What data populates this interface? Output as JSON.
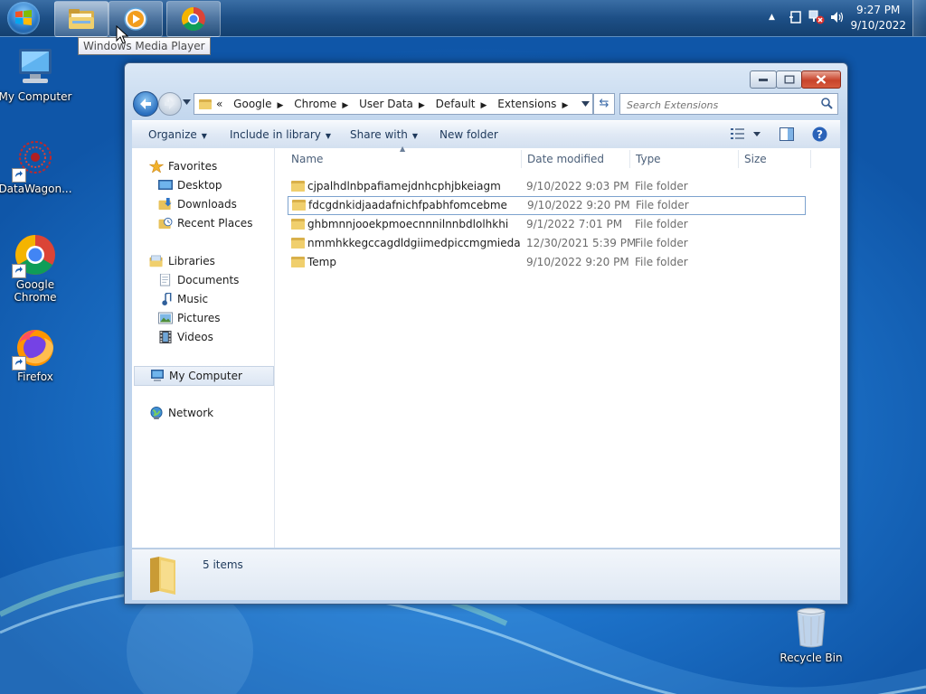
{
  "taskbar": {
    "tooltip": "Windows Media Player",
    "clock_time": "9:27 PM",
    "clock_date": "9/10/2022"
  },
  "desktop": {
    "icons": [
      {
        "label": "My Computer"
      },
      {
        "label": "DataWagon..."
      },
      {
        "label": "Google Chrome"
      },
      {
        "label": "Firefox"
      },
      {
        "label": "Recycle Bin"
      }
    ]
  },
  "window": {
    "breadcrumb_prefix": "«",
    "breadcrumbs": [
      "Google",
      "Chrome",
      "User Data",
      "Default",
      "Extensions"
    ],
    "search_placeholder": "Search Extensions",
    "commands": {
      "organize": "Organize",
      "include_in_library": "Include in library",
      "share_with": "Share with",
      "new_folder": "New folder"
    },
    "nav": {
      "favorites": "Favorites",
      "desktop": "Desktop",
      "downloads": "Downloads",
      "recent_places": "Recent Places",
      "libraries": "Libraries",
      "documents": "Documents",
      "music": "Music",
      "pictures": "Pictures",
      "videos": "Videos",
      "my_computer": "My Computer",
      "network": "Network"
    },
    "columns": {
      "name": "Name",
      "date_modified": "Date modified",
      "type": "Type",
      "size": "Size"
    },
    "files": [
      {
        "name": "cjpalhdlnbpafiamejdnhcphjbkeiagm",
        "date": "9/10/2022 9:03 PM",
        "type": "File folder"
      },
      {
        "name": "fdcgdnkidjaadafnichfpabhfomcebme",
        "date": "9/10/2022 9:20 PM",
        "type": "File folder"
      },
      {
        "name": "ghbmnnjooekpmoecnnnilnnbdlolhkhi",
        "date": "9/1/2022 7:01 PM",
        "type": "File folder"
      },
      {
        "name": "nmmhkkegccagdldgiimedpiccmgmieda",
        "date": "12/30/2021 5:39 PM",
        "type": "File folder"
      },
      {
        "name": "Temp",
        "date": "9/10/2022 9:20 PM",
        "type": "File folder"
      }
    ],
    "status": "5 items"
  },
  "colors": {
    "folder": "#e8c25a",
    "accent": "#1e395b",
    "selection_border": "#7da2ce"
  }
}
